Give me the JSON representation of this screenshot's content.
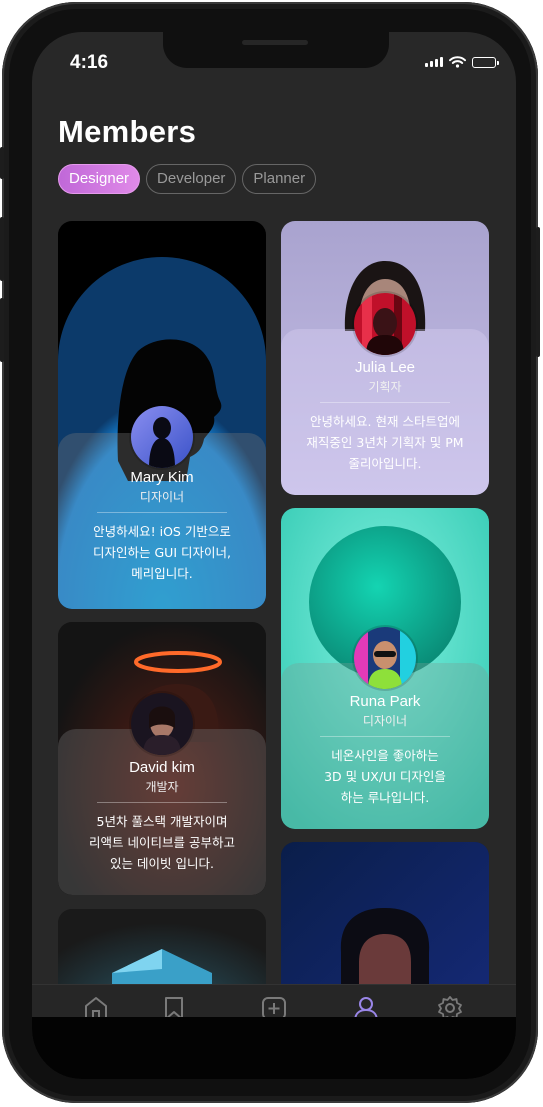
{
  "status_bar": {
    "time": "4:16"
  },
  "page": {
    "title": "Members"
  },
  "filters": [
    {
      "label": "Designer",
      "active": true
    },
    {
      "label": "Developer",
      "active": false
    },
    {
      "label": "Planner",
      "active": false
    }
  ],
  "members": [
    {
      "name": "Mary Kim",
      "role": "디자이너",
      "desc": [
        "안녕하세요! iOS 기반으로",
        "디자인하는 GUI 디자이너,",
        "메리입니다."
      ]
    },
    {
      "name": "Julia Lee",
      "role": "기획자",
      "desc": [
        "안녕하세요. 현재 스타트업에",
        "재직중인 3년차 기획자 및 PM",
        "줄리아입니다."
      ]
    },
    {
      "name": "Runa Park",
      "role": "디자이너",
      "desc": [
        "네온사인을 좋아하는",
        "3D 및 UX/UI 디자인을",
        "하는 루나입니다."
      ]
    },
    {
      "name": "David kim",
      "role": "개발자",
      "desc": [
        "5년차 풀스택 개발자이며",
        "리액트 네이티브를 공부하고",
        "있는 데이빗 입니다."
      ]
    }
  ],
  "tabbar": {
    "tabs": [
      {
        "icon": "home-icon",
        "active": false
      },
      {
        "icon": "bookmark-icon",
        "active": false
      },
      {
        "icon": "add-square-icon",
        "active": false
      },
      {
        "icon": "profile-icon",
        "active": true
      },
      {
        "icon": "settings-icon",
        "active": false
      }
    ],
    "active_color": "#9a86e8",
    "inactive_color": "#7a7a7a"
  },
  "colors": {
    "accent": "#d27ae2",
    "background": "#282828"
  }
}
